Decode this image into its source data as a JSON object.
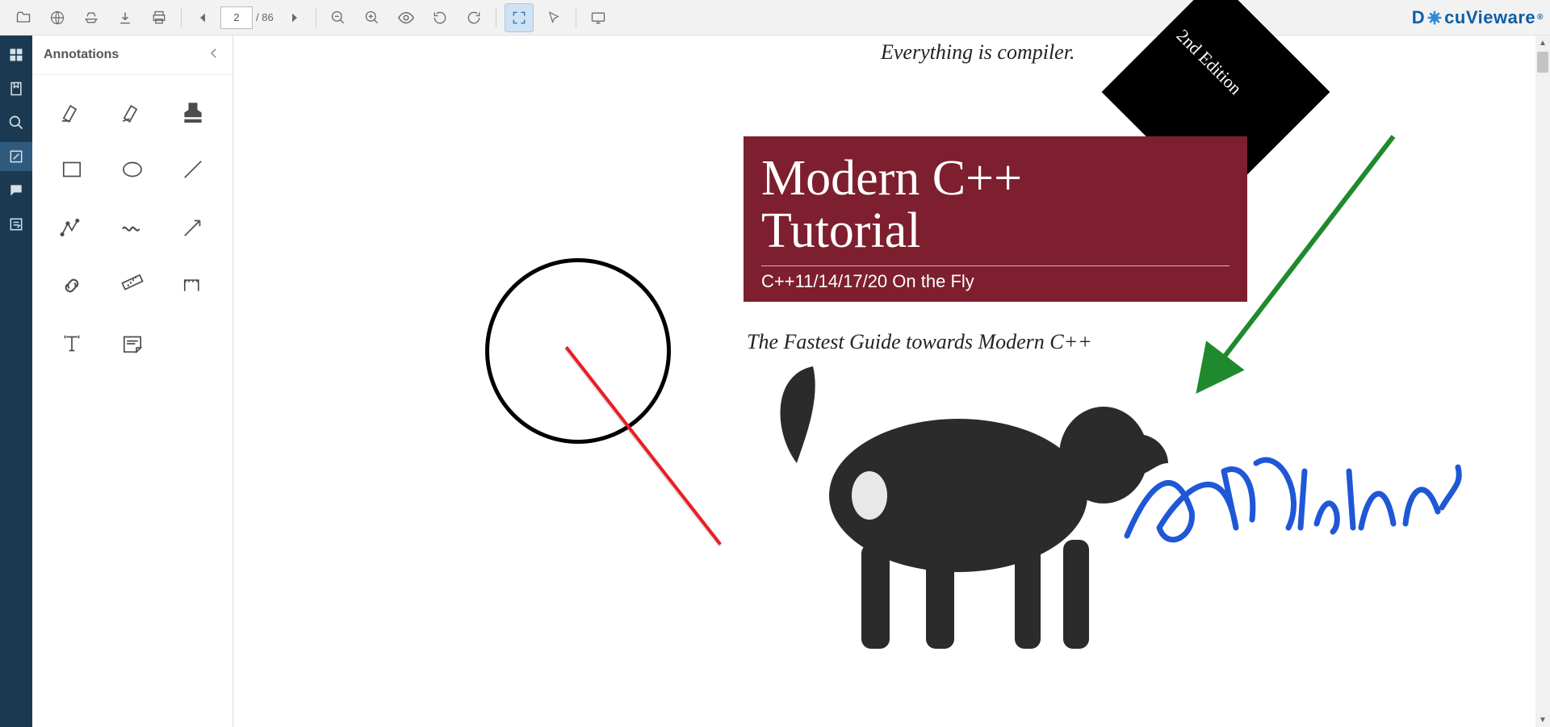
{
  "toolbar": {
    "page_current": "2",
    "page_total": "/ 86"
  },
  "brand": {
    "part1": "D",
    "part2": "cuVieware"
  },
  "palette": {
    "title": "Annotations"
  },
  "document": {
    "tagline": "Everything is compiler.",
    "ribbon": "2nd Edition",
    "title_line1": "Modern C++",
    "title_line2": "Tutorial",
    "title_sub": "C++11/14/17/20 On the Fly",
    "subtitle": "The Fastest Guide towards Modern C++",
    "signature_text": "GdPicture"
  },
  "rail": {
    "items": [
      "thumbnails",
      "bookmarks",
      "search",
      "annotations",
      "comments",
      "form"
    ]
  }
}
